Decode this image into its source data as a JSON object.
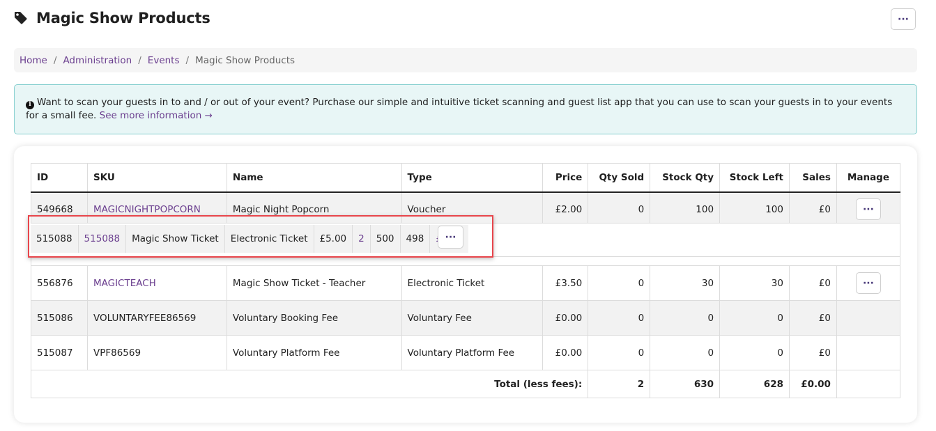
{
  "header": {
    "title": "Magic Show Products",
    "menu_label": "···"
  },
  "breadcrumb": {
    "items": [
      "Home",
      "Administration",
      "Events"
    ],
    "current": "Magic Show Products",
    "separator": "/"
  },
  "alert": {
    "icon_glyph": "i",
    "text": "Want to scan your guests in to and / or out of your event? Purchase our simple and intuitive ticket scanning and guest list app that you can use to scan your guests in to your events for a small fee.",
    "link_text": "See more information →"
  },
  "table": {
    "headers": {
      "id": "ID",
      "sku": "SKU",
      "name": "Name",
      "type": "Type",
      "price": "Price",
      "qty_sold": "Qty Sold",
      "stock_qty": "Stock Qty",
      "stock_left": "Stock Left",
      "sales": "Sales",
      "manage": "Manage"
    },
    "rows": [
      {
        "id": "549668",
        "sku": "MAGICNIGHTPOPCORN",
        "name": "Magic Night Popcorn",
        "type": "Voucher",
        "price": "£2.00",
        "qty_sold": "0",
        "stock_qty": "100",
        "stock_left": "100",
        "sales": "£0",
        "manage": "···"
      },
      {
        "id": "556876",
        "sku": "MAGICTEACH",
        "name": "Magic Show Ticket - Teacher",
        "type": "Electronic Ticket",
        "price": "£3.50",
        "qty_sold": "0",
        "stock_qty": "30",
        "stock_left": "30",
        "sales": "£0",
        "manage": "···"
      },
      {
        "id": "515086",
        "sku": "VOLUNTARYFEE86569",
        "name": "Voluntary Booking Fee",
        "type": "Voluntary Fee",
        "price": "£0.00",
        "qty_sold": "0",
        "stock_qty": "0",
        "stock_left": "0",
        "sales": "£0"
      },
      {
        "id": "515087",
        "sku": "VPF86569",
        "name": "Voluntary Platform Fee",
        "type": "Voluntary Platform Fee",
        "price": "£0.00",
        "qty_sold": "0",
        "stock_qty": "0",
        "stock_left": "0",
        "sales": "£0"
      }
    ],
    "total": {
      "label": "Total (less fees):",
      "qty_sold": "2",
      "stock_qty": "630",
      "stock_left": "628",
      "sales": "£0.00"
    }
  },
  "dragged_row": {
    "id": "515088",
    "sku": "515088",
    "name": "Magic Show Ticket",
    "type": "Electronic Ticket",
    "price": "£5.00",
    "qty_sold": "2",
    "stock_qty": "500",
    "stock_left": "498",
    "sales": "£0.00",
    "manage": "···"
  },
  "colors": {
    "link": "#6b3f8f",
    "alert_bg": "#e8f6f6",
    "alert_border": "#86cfcf",
    "highlight": "#e8454b"
  }
}
